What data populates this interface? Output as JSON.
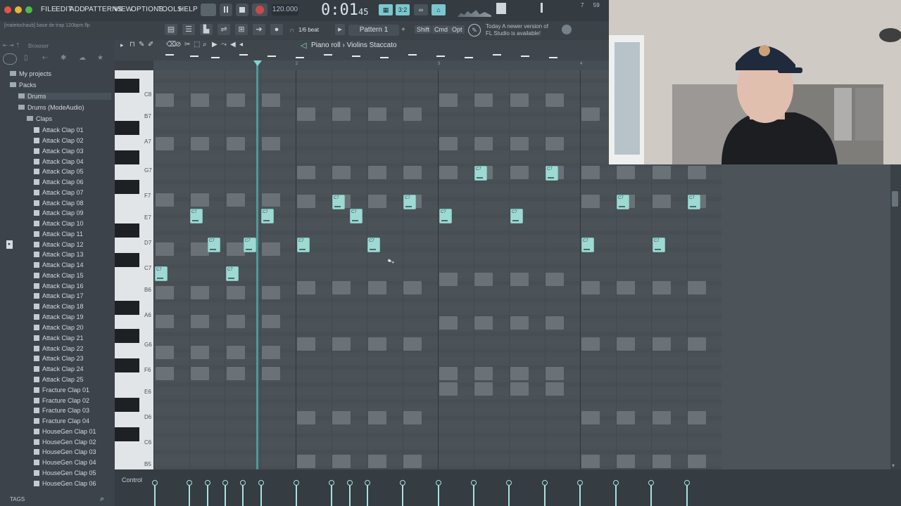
{
  "menu": [
    "FILE",
    "EDIT",
    "ADD",
    "PATTERNS",
    "VIEW",
    "OPTIONS",
    "TOOLS",
    "HELP"
  ],
  "tempo": "120.000",
  "time": {
    "main": "0:01",
    "sub": "45"
  },
  "hint": {
    "line1": "Today  A newer version of",
    "line2": "FL Studio is available!"
  },
  "filepath": "[matetochaub] base de trap 120bpm.flp",
  "snap": "1/6 beat",
  "pattern": "Pattern 1",
  "mods": [
    "Shift",
    "Cmd",
    "Opt"
  ],
  "browser": {
    "header": "Browser",
    "tree": [
      {
        "label": "My projects",
        "indent": 0,
        "type": "folder"
      },
      {
        "label": "Packs",
        "indent": 0,
        "type": "folder"
      },
      {
        "label": "Drums",
        "indent": 1,
        "type": "folder",
        "selected": true
      },
      {
        "label": "Drums (ModeAudio)",
        "indent": 1,
        "type": "folder"
      },
      {
        "label": "Claps",
        "indent": 2,
        "type": "folder"
      },
      {
        "label": "Attack Clap 01",
        "indent": 3,
        "type": "file"
      },
      {
        "label": "Attack Clap 02",
        "indent": 3,
        "type": "file"
      },
      {
        "label": "Attack Clap 03",
        "indent": 3,
        "type": "file"
      },
      {
        "label": "Attack Clap 04",
        "indent": 3,
        "type": "file"
      },
      {
        "label": "Attack Clap 05",
        "indent": 3,
        "type": "file"
      },
      {
        "label": "Attack Clap 06",
        "indent": 3,
        "type": "file"
      },
      {
        "label": "Attack Clap 07",
        "indent": 3,
        "type": "file"
      },
      {
        "label": "Attack Clap 08",
        "indent": 3,
        "type": "file"
      },
      {
        "label": "Attack Clap 09",
        "indent": 3,
        "type": "file"
      },
      {
        "label": "Attack Clap 10",
        "indent": 3,
        "type": "file"
      },
      {
        "label": "Attack Clap 11",
        "indent": 3,
        "type": "file"
      },
      {
        "label": "Attack Clap 12",
        "indent": 4,
        "type": "file"
      },
      {
        "label": "Attack Clap 13",
        "indent": 3,
        "type": "file"
      },
      {
        "label": "Attack Clap 14",
        "indent": 3,
        "type": "file"
      },
      {
        "label": "Attack Clap 15",
        "indent": 3,
        "type": "file"
      },
      {
        "label": "Attack Clap 16",
        "indent": 3,
        "type": "file"
      },
      {
        "label": "Attack Clap 17",
        "indent": 3,
        "type": "file"
      },
      {
        "label": "Attack Clap 18",
        "indent": 3,
        "type": "file"
      },
      {
        "label": "Attack Clap 19",
        "indent": 3,
        "type": "file"
      },
      {
        "label": "Attack Clap 20",
        "indent": 3,
        "type": "file"
      },
      {
        "label": "Attack Clap 21",
        "indent": 3,
        "type": "file"
      },
      {
        "label": "Attack Clap 22",
        "indent": 3,
        "type": "file"
      },
      {
        "label": "Attack Clap 23",
        "indent": 3,
        "type": "file"
      },
      {
        "label": "Attack Clap 24",
        "indent": 3,
        "type": "file"
      },
      {
        "label": "Attack Clap 25",
        "indent": 3,
        "type": "file"
      },
      {
        "label": "Fracture Clap 01",
        "indent": 3,
        "type": "file"
      },
      {
        "label": "Fracture Clap 02",
        "indent": 3,
        "type": "file"
      },
      {
        "label": "Fracture Clap 03",
        "indent": 3,
        "type": "file"
      },
      {
        "label": "Fracture Clap 04",
        "indent": 3,
        "type": "file"
      },
      {
        "label": "HouseGen Clap 01",
        "indent": 3,
        "type": "file"
      },
      {
        "label": "HouseGen Clap 02",
        "indent": 3,
        "type": "file"
      },
      {
        "label": "HouseGen Clap 03",
        "indent": 3,
        "type": "file"
      },
      {
        "label": "HouseGen Clap 04",
        "indent": 3,
        "type": "file"
      },
      {
        "label": "HouseGen Clap 05",
        "indent": 3,
        "type": "file"
      },
      {
        "label": "HouseGen Clap 06",
        "indent": 3,
        "type": "file"
      }
    ],
    "tags": "TAGS"
  },
  "pianoroll": {
    "title": "Piano roll › Violins Staccato",
    "ruler": [
      "2",
      "3",
      "4"
    ],
    "keys": [
      "C8",
      "B7",
      "A7",
      "G7",
      "F7",
      "E7",
      "D7",
      "C7",
      "B6",
      "A6",
      "G6",
      "F6",
      "E6",
      "D6",
      "C6",
      "B5"
    ],
    "note_label": "C7",
    "control_label": "Control"
  },
  "colors": {
    "note": "#9ed9d4",
    "playhead": "#4fa6a0",
    "ghost": "#6a7177"
  }
}
